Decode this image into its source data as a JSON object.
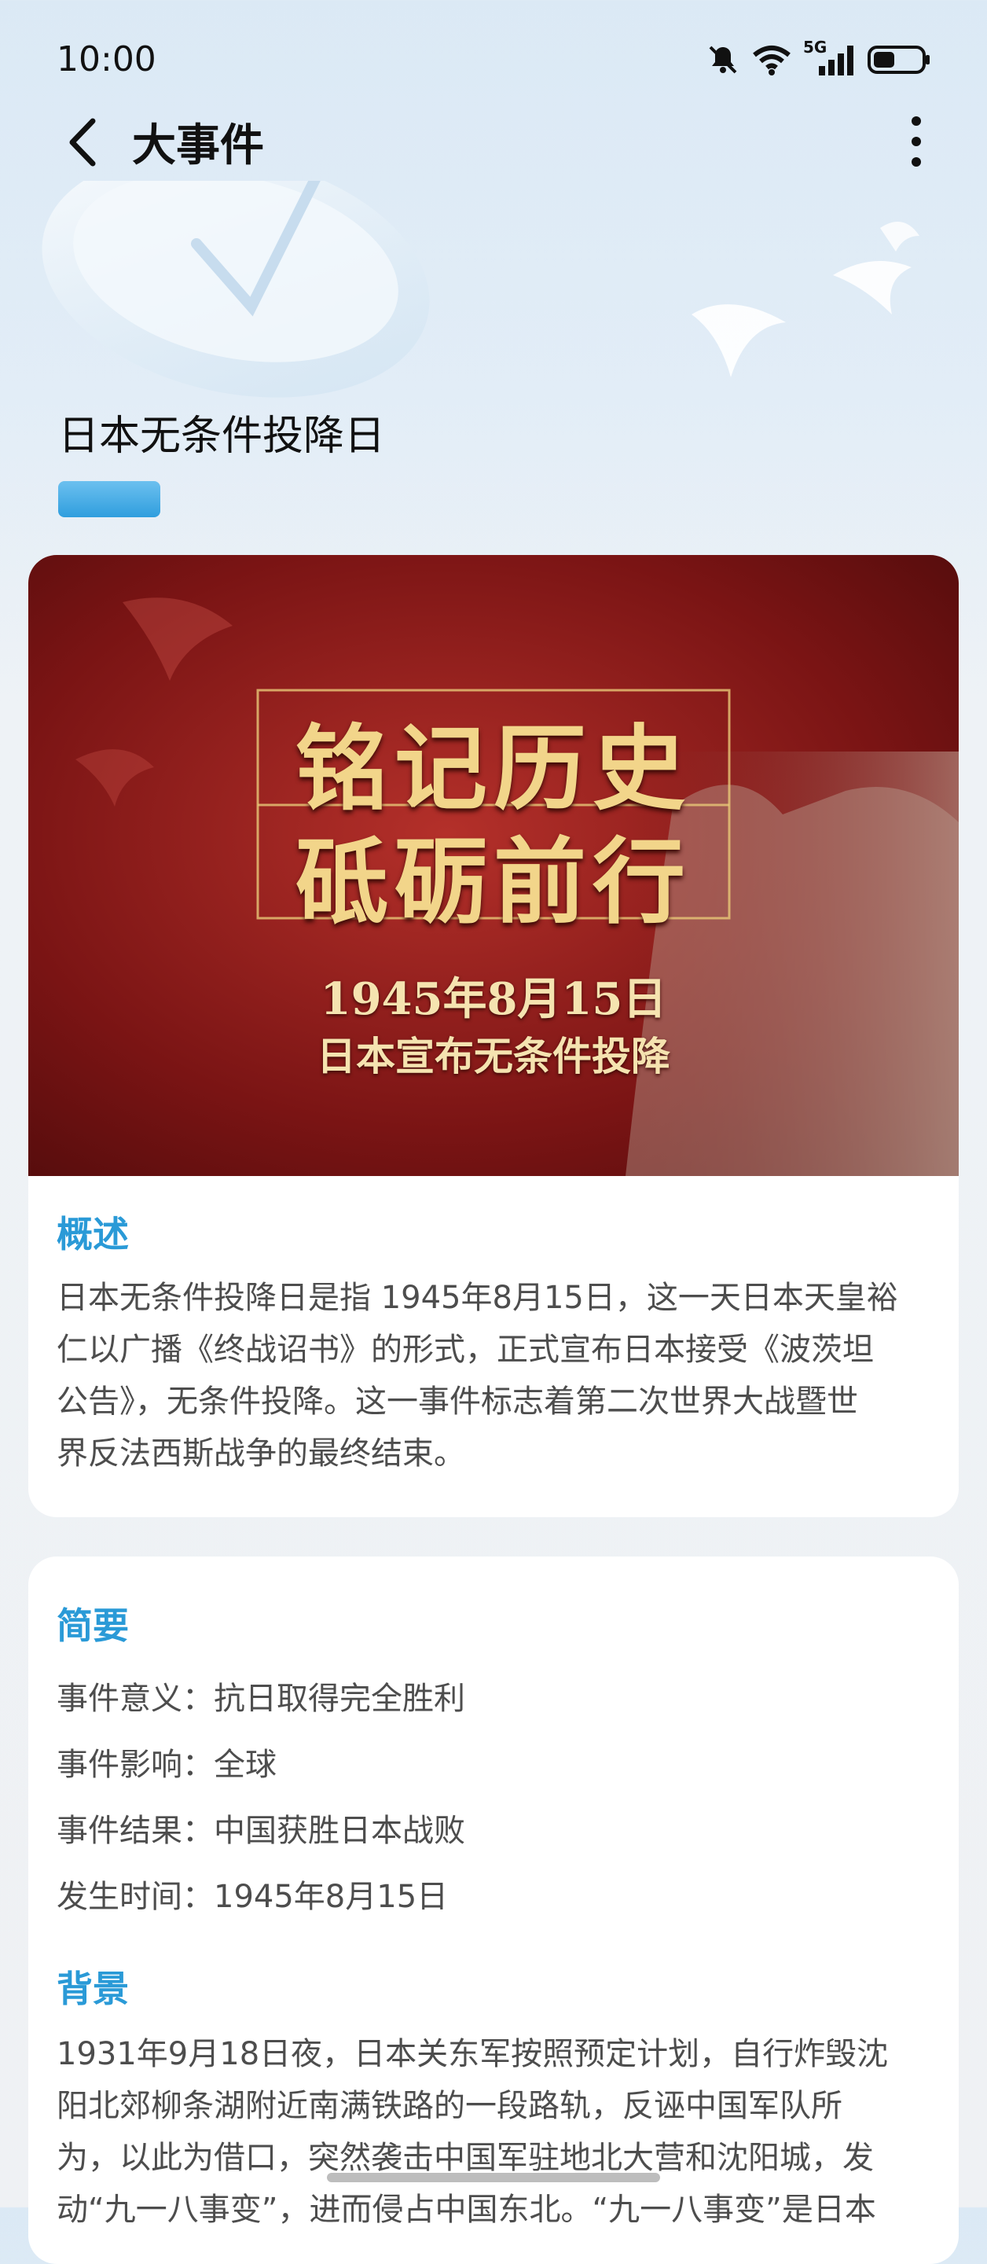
{
  "status": {
    "time": "10:00",
    "network": "5G"
  },
  "nav": {
    "title": "大事件"
  },
  "event": {
    "title": "日本无条件投降日"
  },
  "banner": {
    "line1": "铭记历史",
    "line2": "砥砺前行",
    "date": "1945年8月15日",
    "subtitle": "日本宣布无条件投降"
  },
  "overview": {
    "heading": "概述",
    "lines": [
      "日本无条件投降日是指 1945年8月15日，这一天日本天皇裕",
      "仁以广播《终战诏书》的形式，正式宣布日本接受《波茨坦",
      "公告》，无条件投降。这一事件标志着第二次世界大战暨世",
      "界反法西斯战争的最终结束。"
    ]
  },
  "summary": {
    "heading": "简要",
    "items": [
      {
        "label": "事件意义：",
        "value": "抗日取得完全胜利"
      },
      {
        "label": "事件影响：",
        "value": "全球"
      },
      {
        "label": "事件结果：",
        "value": "中国获胜日本战败"
      },
      {
        "label": "发生时间：",
        "value": "1945年8月15日"
      }
    ]
  },
  "background": {
    "heading": "背景",
    "lines": [
      "1931年9月18日夜，日本关东军按照预定计划，自行炸毁沈",
      "阳北郊柳条湖附近南满铁路的一段路轨，反诬中国军队所",
      "为，以此为借口，突然袭击中国军驻地北大营和沈阳城，发",
      "动“九一八事变”，进而侵占中国东北。“九一八事变”是日本"
    ]
  },
  "colors": {
    "accent": "#2a9ad7",
    "banner_red": "#7a1414",
    "gold": "#e8c878"
  }
}
